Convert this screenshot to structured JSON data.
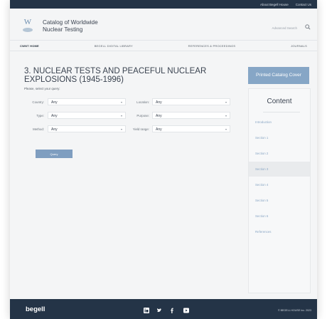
{
  "topbar": {
    "links": [
      "About Begell House",
      "Contact Us"
    ]
  },
  "header": {
    "logo_letter": "W",
    "title_line1": "Catalog of Worldwide",
    "title_line2": "Nuclear Testing",
    "advanced_search": "Advanced Search"
  },
  "nav": [
    "CWNT HOME",
    "BEGELL DIGITAL LIBRARY",
    "REFERENCES & PROCEEDINGS",
    "JOURNALS"
  ],
  "page": {
    "title": "3. NUCLEAR TESTS AND PEACEFUL NUCLEAR EXPLOSIONS (1945-1996)",
    "prompt": "Please, select your query:",
    "fields": {
      "country": {
        "label": "Country:",
        "value": "Any"
      },
      "location": {
        "label": "Location:",
        "value": "Any"
      },
      "type": {
        "label": "Type:",
        "value": "Any"
      },
      "purpose": {
        "label": "Purpose:",
        "value": "Any"
      },
      "method": {
        "label": "Method:",
        "value": "Any"
      },
      "yield_range": {
        "label": "Yield range:",
        "value": "Any"
      }
    },
    "query_button": "Query"
  },
  "sidebar": {
    "cover_button": "Printed Catalog Cover",
    "content_title": "Content",
    "items": [
      "Introduction",
      "Section 1",
      "Section 2",
      "Section 3",
      "Section 4",
      "Section 5",
      "Section 6",
      "References"
    ],
    "active_index": 3
  },
  "footer": {
    "brand": "begell",
    "copyright": "© BEGELL HOUSE Inc. 2023"
  },
  "colors": {
    "dark": "#243447",
    "accent": "#86a6c6"
  }
}
